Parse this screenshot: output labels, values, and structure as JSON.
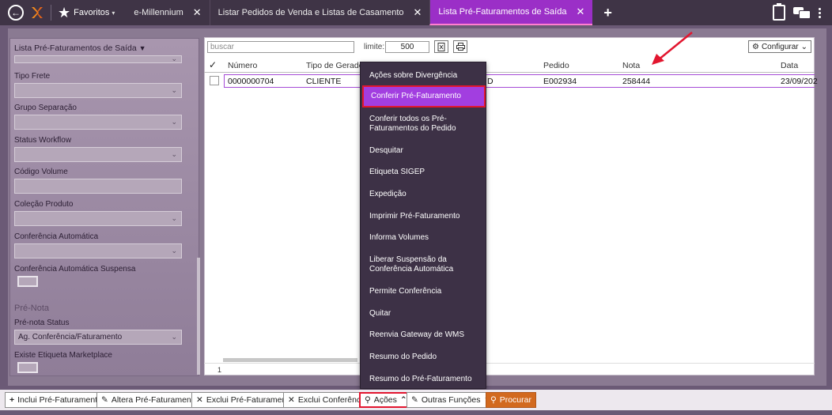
{
  "topbar": {
    "favorites_label": "Favoritos",
    "tabs": [
      {
        "label": "e-Millennium",
        "active": false
      },
      {
        "label": "Listar Pedidos de Venda e Listas de Casamento",
        "active": false
      },
      {
        "label": "Lista Pré-Faturamentos de Saída",
        "active": true
      }
    ],
    "close_glyph": "✕",
    "plus_glyph": "+",
    "accent": "#9b2fc7"
  },
  "left_panel": {
    "title": "Lista Pré-Faturamentos de Saída",
    "fields": [
      {
        "label": "Tipo Frete",
        "type": "select",
        "value": ""
      },
      {
        "label": "Grupo Separação",
        "type": "select",
        "value": ""
      },
      {
        "label": "Status Workflow",
        "type": "select",
        "value": ""
      },
      {
        "label": "Código Volume",
        "type": "input",
        "value": ""
      },
      {
        "label": "Coleção Produto",
        "type": "select",
        "value": ""
      },
      {
        "label": "Conferência Automática",
        "type": "select",
        "value": ""
      },
      {
        "label": "Conferência Automática Suspensa",
        "type": "toggle",
        "value": ""
      }
    ],
    "section_title": "Pré-Nota",
    "section_fields": [
      {
        "label": "Pré-nota Status",
        "type": "select",
        "value": "Ag. Conferência/Faturamento"
      },
      {
        "label": "Existe Etiqueta Marketplace",
        "type": "toggle",
        "value": ""
      }
    ]
  },
  "grid": {
    "search_placeholder": "buscar",
    "limit_label": "limite:",
    "limit_value": "500",
    "configure_label": "Configurar",
    "columns": [
      "Número",
      "Tipo de Gerador",
      "Pedido",
      "Nota",
      "Data"
    ],
    "rows": [
      {
        "numero": "0000000704",
        "tipo_gerador": "CLIENTE",
        "partial": "D",
        "pedido": "E002934",
        "nota": "258444",
        "data": "23/09/202"
      }
    ],
    "page": "1"
  },
  "actions_menu": {
    "items": [
      "Ações sobre Divergência",
      "Conferir Pré-Faturamento",
      "Conferir todos os Pré-Faturamentos do Pedido",
      "Desquitar",
      "Etiqueta SIGEP",
      "Expedição",
      "Imprimir Pré-Faturamento",
      "Informa Volumes",
      "Liberar Suspensão da Conferência Automática",
      "Permite Conferência",
      "Quitar",
      "Reenvia Gateway de WMS",
      "Resumo do Pedido",
      "Resumo do Pré-Faturamento"
    ],
    "highlighted": "Conferir Pré-Faturamento"
  },
  "bottombar": {
    "buttons": [
      {
        "label": "Inclui Pré-Faturamento",
        "icon": "plus-icon"
      },
      {
        "label": "Altera Pré-Faturamento",
        "icon": "edit-icon"
      },
      {
        "label": "Exclui Pré-Faturamento",
        "icon": "x-icon"
      },
      {
        "label": "Exclui Conferência",
        "icon": "x-icon"
      },
      {
        "label": "Ações",
        "icon": "lightbulb-icon"
      },
      {
        "label": "Outras Funções",
        "icon": "edit-icon"
      },
      {
        "label": "Procurar",
        "icon": "search-icon"
      }
    ]
  }
}
